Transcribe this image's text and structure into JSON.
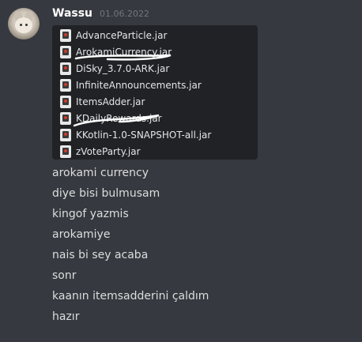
{
  "author": {
    "name": "Wassu",
    "timestamp": "01.06.2022"
  },
  "files": [
    {
      "name": "AdvanceParticle.jar",
      "icon": "jar-file-icon"
    },
    {
      "name": "ArokamiCurrency.jar",
      "icon": "jar-file-icon",
      "scribbled": true
    },
    {
      "name": "DiSky_3.7.0-ARK.jar",
      "icon": "jar-file-icon"
    },
    {
      "name": "InfiniteAnnouncements.jar",
      "icon": "jar-file-icon"
    },
    {
      "name": "ItemsAdder.jar",
      "icon": "jar-file-icon"
    },
    {
      "name": "KDailyRewards.jar",
      "icon": "jar-file-icon",
      "scribbled": true
    },
    {
      "name": "KKotlin-1.0-SNAPSHOT-all.jar",
      "icon": "jar-file-icon"
    },
    {
      "name": "zVoteParty.jar",
      "icon": "jar-file-icon"
    }
  ],
  "messages": [
    "arokami currency",
    "diye bisi bulmusam",
    "kingof yazmis",
    "arokamiye",
    "nais bi sey acaba",
    "sonr",
    "kaanın itemsadderini çaldım",
    "hazır"
  ],
  "colors": {
    "background": "#36393f",
    "file_box": "#202225",
    "username": "#ffffff",
    "timestamp": "#72767d",
    "text": "#dcddde",
    "scribble": "#ffffff"
  }
}
